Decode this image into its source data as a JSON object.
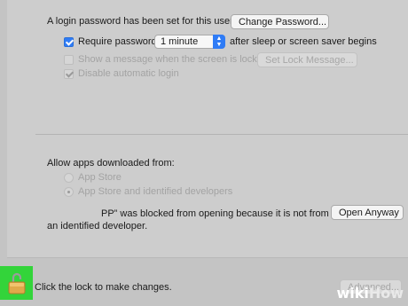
{
  "password": {
    "status_text": "A login password has been set for this user",
    "change_button": "Change Password..."
  },
  "options": {
    "require_password": {
      "label": "Require password",
      "checked": true,
      "delay_value": "1 minute",
      "suffix": "after sleep or screen saver begins"
    },
    "show_message": {
      "label": "Show a message when the screen is locked",
      "checked": false,
      "button": "Set Lock Message..."
    },
    "disable_auto_login": {
      "label": "Disable automatic login",
      "checked": true
    }
  },
  "downloads": {
    "heading": "Allow apps downloaded from:",
    "options": [
      {
        "label": "App Store",
        "selected": false
      },
      {
        "label": "App Store and identified developers",
        "selected": true
      }
    ],
    "blocked_line1": "PP” was blocked from opening because it is not from",
    "blocked_line2": "an identified developer.",
    "open_anyway_button": "Open Anyway"
  },
  "footer": {
    "lock_text": "Click the lock to make changes.",
    "advanced_button": "Advanced...",
    "highlight_color": "#33d43a",
    "lock_icon": "padlock-open-icon"
  },
  "watermark": {
    "wiki": "wiki",
    "how": "How"
  }
}
